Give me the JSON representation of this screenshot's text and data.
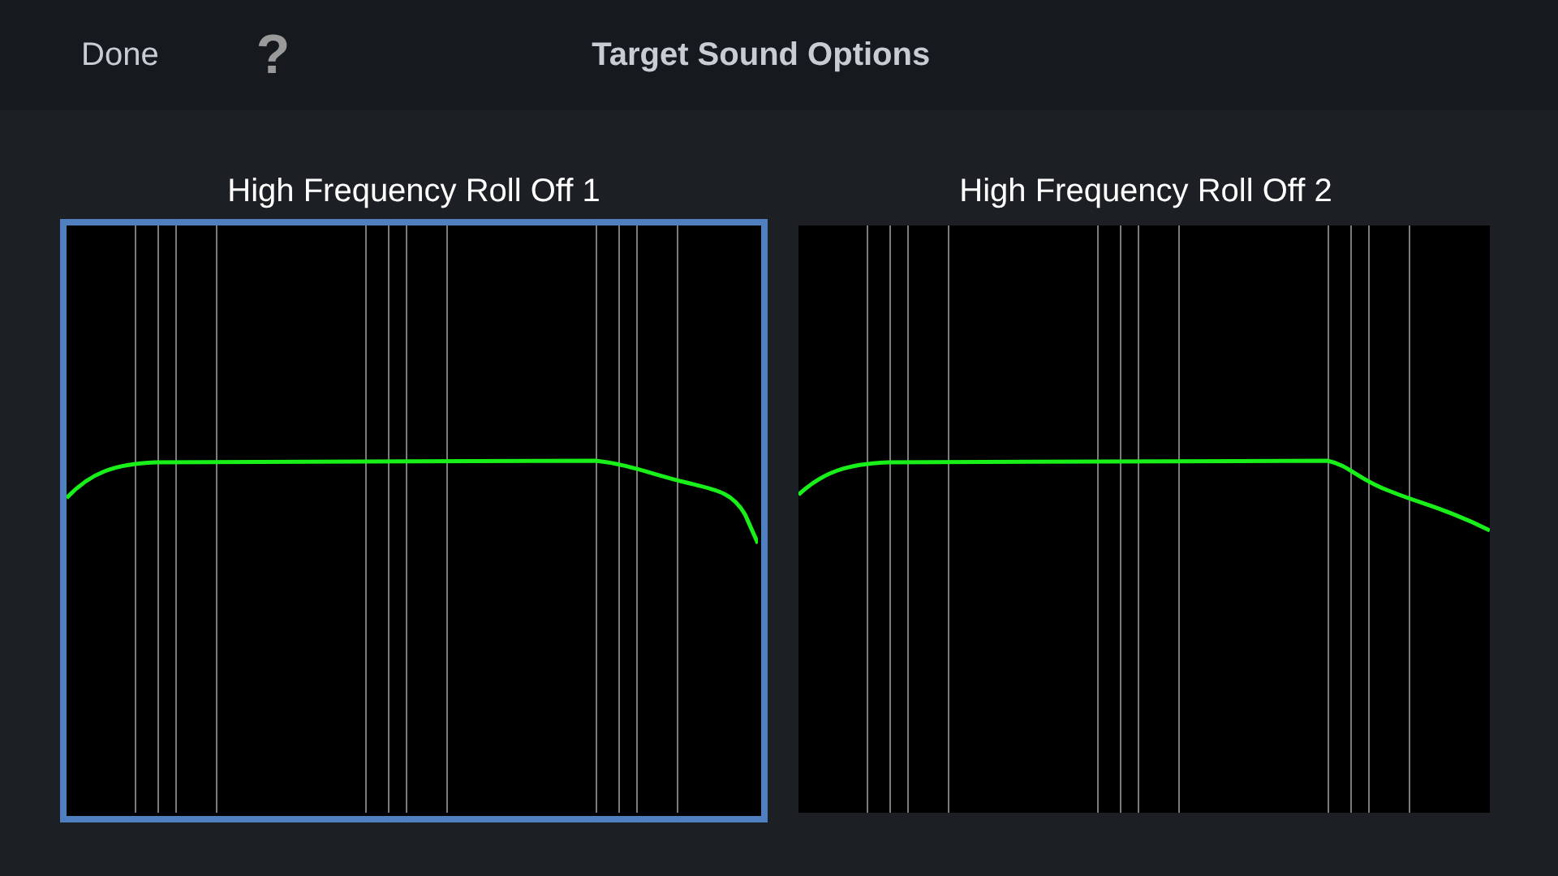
{
  "header": {
    "done": "Done",
    "help": "?",
    "title": "Target Sound Options"
  },
  "options": [
    {
      "label": "High Frequency Roll Off 1",
      "selected": true,
      "kind": "steep"
    },
    {
      "label": "High Frequency Roll Off 2",
      "selected": false,
      "kind": "gentle"
    }
  ]
}
